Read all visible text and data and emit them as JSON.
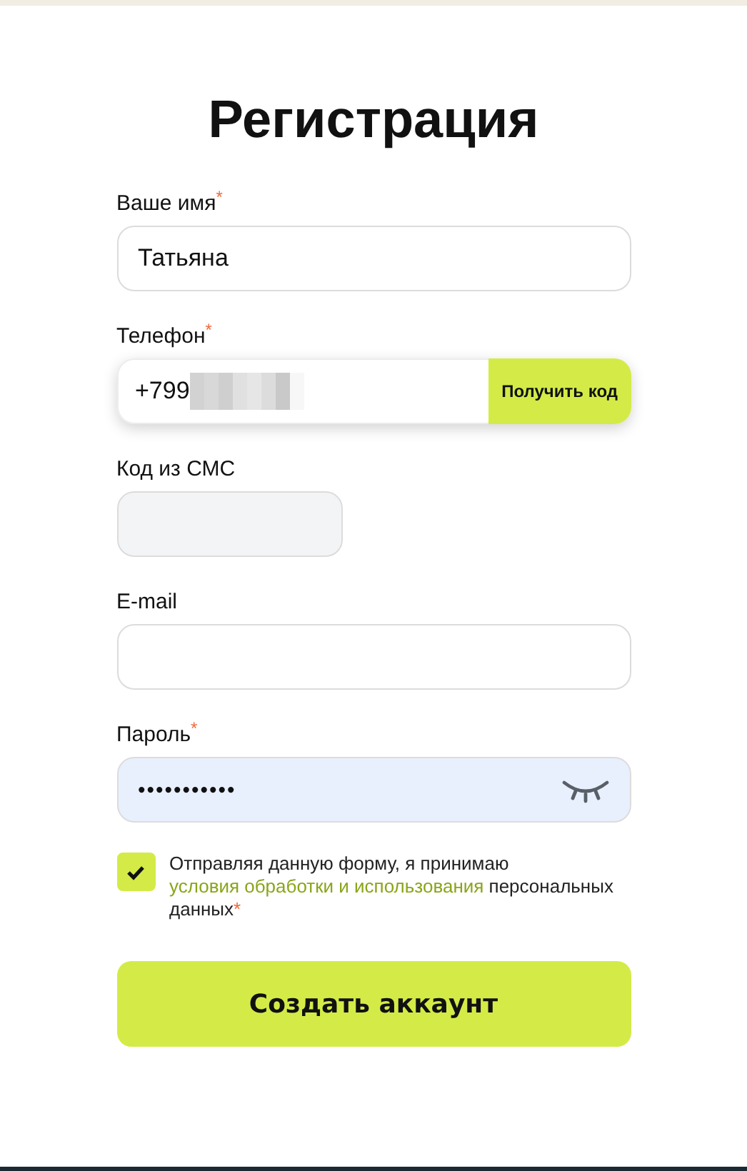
{
  "title": "Регистрация",
  "fields": [
    {
      "kind": "text",
      "label": "Ваше имя",
      "required_mark": "*",
      "value": "Татьяна"
    },
    {
      "kind": "phone",
      "label": "Телефон",
      "required_mark": "*",
      "value": "+799",
      "redacted": true,
      "action": "Получить код"
    },
    {
      "kind": "code",
      "label": "Код из СМС"
    },
    {
      "kind": "text",
      "label": "E-mail"
    },
    {
      "kind": "password",
      "label": "Пароль",
      "required_mark": "*",
      "value": "•••••••••••"
    }
  ],
  "consent": {
    "checked": true,
    "text_before": "Отправляя данную форму, я принимаю ",
    "link": "условия обработки и использования",
    "text_after": " персональных данных",
    "required_mark": "*"
  },
  "submit": "Создать аккаунт"
}
